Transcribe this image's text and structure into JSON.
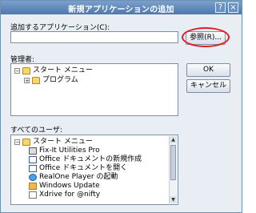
{
  "window": {
    "title": "新規アプリケーションの追加",
    "help_symbol": "?",
    "close_symbol": "×"
  },
  "app_field": {
    "label": "追加するアプリケーション(C):",
    "value": ""
  },
  "buttons": {
    "browse": "参照(R)...",
    "ok": "OK",
    "cancel": "キャンセル"
  },
  "managers": {
    "label": "管理者:",
    "items": [
      {
        "label": "スタート メニュー",
        "icon": "folder-icon"
      },
      {
        "label": "プログラム",
        "icon": "programs-folder-icon"
      }
    ]
  },
  "all_users": {
    "label": "すべてのユーザ:",
    "items": [
      {
        "label": "スタート メニュー",
        "icon": "folder-icon"
      },
      {
        "label": "Fix-It Utilities Pro",
        "icon": "app-icon"
      },
      {
        "label": "Office ドキュメントの新規作成",
        "icon": "document-icon"
      },
      {
        "label": "Office ドキュメントを開く",
        "icon": "document-icon"
      },
      {
        "label": "RealOne Player の起動",
        "icon": "globe-icon"
      },
      {
        "label": "Windows Update",
        "icon": "windows-update-icon"
      },
      {
        "label": "Xdrive for @nifty",
        "icon": "x-icon"
      }
    ]
  }
}
